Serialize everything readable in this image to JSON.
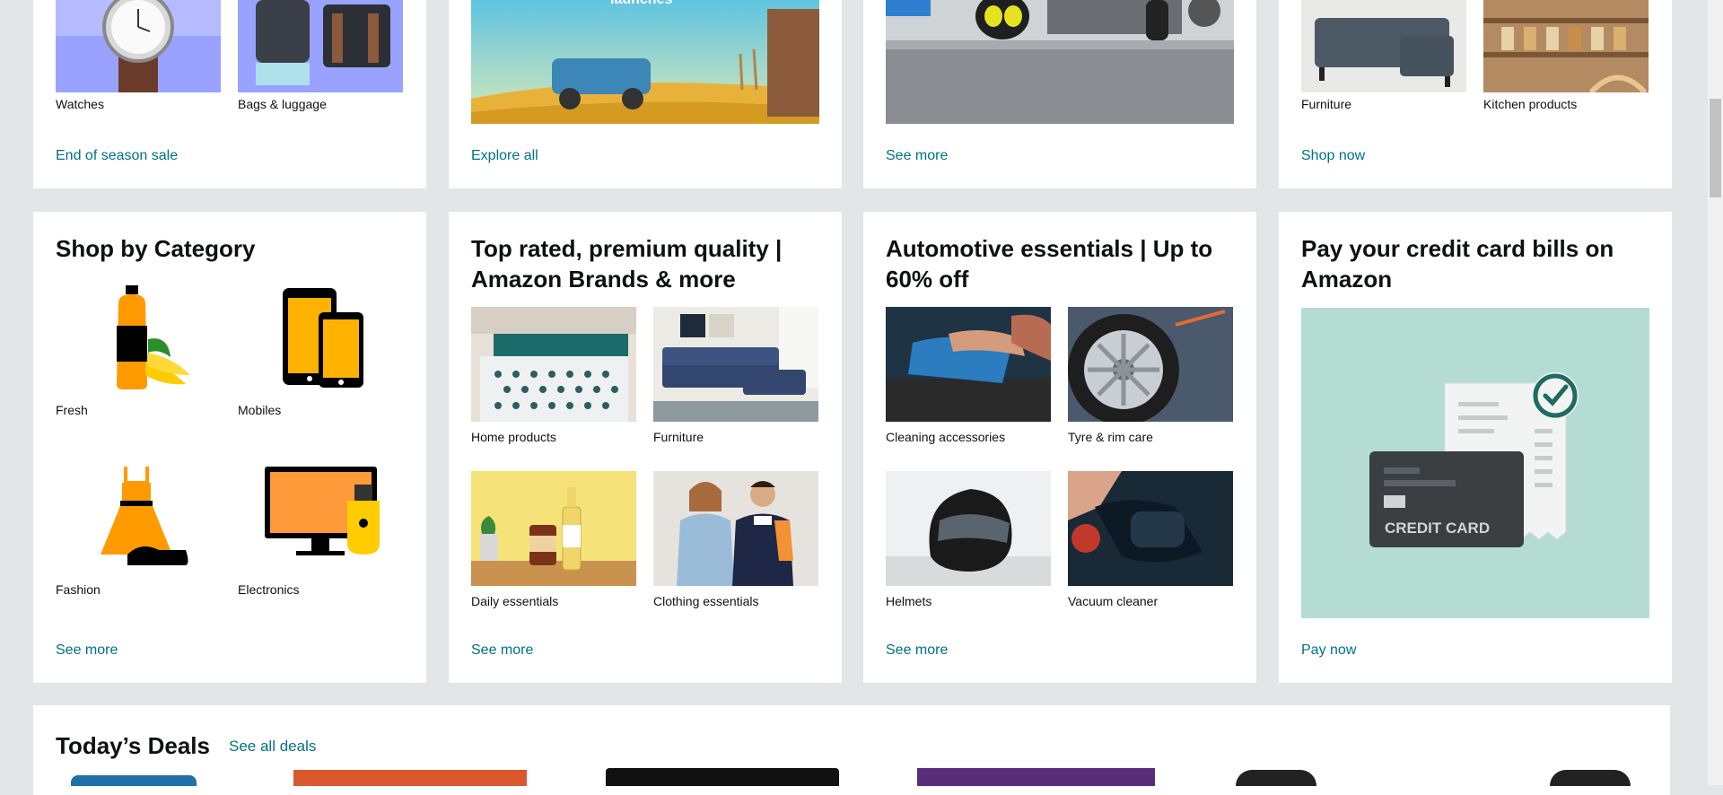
{
  "top_row": [
    {
      "link": "End of season sale",
      "tiles": [
        "Watches",
        "Bags & luggage"
      ]
    },
    {
      "link": "Explore all",
      "banner_text": "launches"
    },
    {
      "link": "See more"
    },
    {
      "link": "Shop now",
      "tiles": [
        "Furniture",
        "Kitchen products"
      ]
    }
  ],
  "shop_by_category": {
    "title": "Shop by Category",
    "items": [
      "Fresh",
      "Mobiles",
      "Fashion",
      "Electronics"
    ],
    "link": "See more"
  },
  "premium": {
    "title": "Top rated, premium quality | Amazon Brands & more",
    "items": [
      "Home products",
      "Furniture",
      "Daily essentials",
      "Clothing essentials"
    ],
    "link": "See more"
  },
  "automotive": {
    "title": "Automotive essentials | Up to 60% off",
    "items": [
      "Cleaning accessories",
      "Tyre & rim care",
      "Helmets",
      "Vacuum cleaner"
    ],
    "link": "See more"
  },
  "credit_card": {
    "title": "Pay your credit card bills on Amazon",
    "card_text": "CREDIT CARD",
    "link": "Pay now"
  },
  "deals": {
    "title": "Today’s Deals",
    "link": "See all deals"
  }
}
